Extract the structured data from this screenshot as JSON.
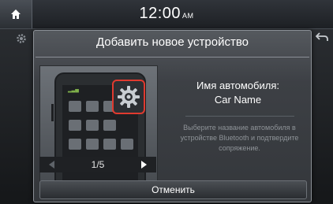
{
  "status_bar": {
    "time": "12:00",
    "ampm": "AM"
  },
  "popup": {
    "title": "Добавить новое устройство",
    "car_label": "Имя автомобиля:",
    "car_name": "Car Name",
    "instructions": "Выберите название автомобиля в устройстве Bluetooth и подтвердите сопряжение.",
    "pager": "1/5",
    "cancel_label": "Отменить"
  },
  "icons": {
    "home": "home-icon",
    "settings": "gear-icon",
    "back": "back-arrow-icon",
    "prev": "prev-arrow-icon",
    "next": "next-arrow-icon"
  },
  "colors": {
    "highlight": "#e03a2f",
    "background": "#1a1c1f"
  }
}
